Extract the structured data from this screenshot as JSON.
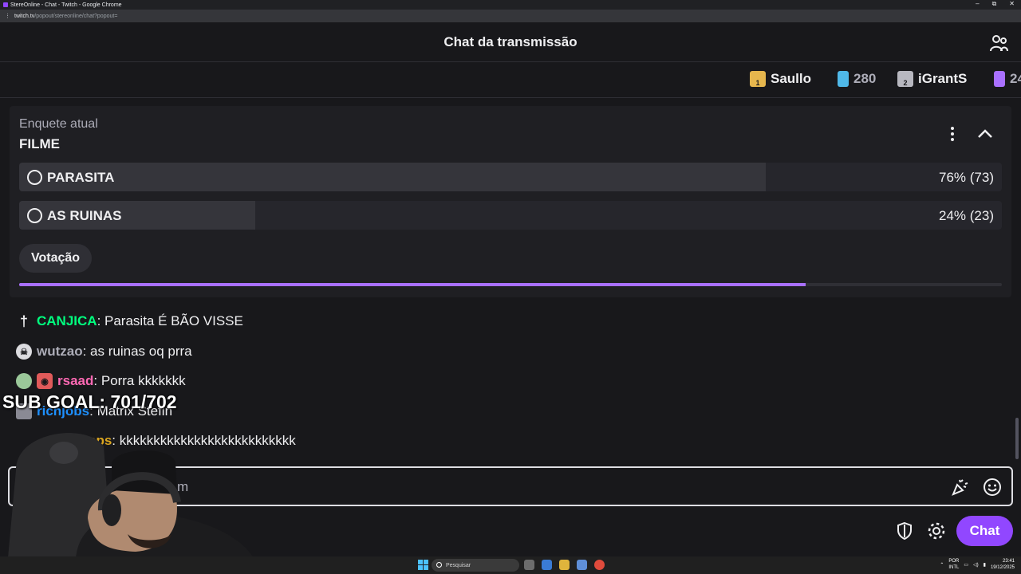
{
  "browser": {
    "window_title": "StereOnline - Chat - Twitch - Google Chrome",
    "url_host": "twitch.tv",
    "url_path": "/popout/stereonline/chat?popout=",
    "controls": [
      "–",
      "⧉",
      "✕"
    ]
  },
  "header": {
    "title": "Chat da transmissão",
    "users_icon": "users-icon"
  },
  "leaderboard": {
    "items": [
      {
        "rank": "1",
        "name": "Saullo",
        "color": "#e6b64d"
      },
      {
        "rank": "",
        "name": "280",
        "color": "#4fb8e8"
      },
      {
        "rank": "2",
        "name": "iGrantS",
        "color": "#b8b8c0"
      },
      {
        "rank": "",
        "name": "24",
        "color": "#a970ff"
      }
    ]
  },
  "poll": {
    "label": "Enquete atual",
    "title": "FILME",
    "options": [
      {
        "name": "PARASITA",
        "result": "76% (73)",
        "fraction": 0.76
      },
      {
        "name": "AS RUINAS",
        "result": "24% (23)",
        "fraction": 0.24
      }
    ],
    "vote_label": "Votação",
    "time_progress": 0.8
  },
  "messages": [
    {
      "badge": "sword-badge",
      "badge_color": "#efeff1",
      "user": "CANJICA",
      "user_color": "#00ff7f",
      "text": ": Parasita É BÃO VISSE"
    },
    {
      "badge": "skull-badge",
      "badge_color": "#dcdce0",
      "user": "wutzao",
      "user_color": "#adadb8",
      "text": ": as ruinas oq prra"
    },
    {
      "badge": "sub-badge",
      "badge_color": "#e05a5a",
      "user": "rsaad",
      "user_color": "#ff69b4",
      "text": ": Porra kkkkkkk"
    },
    {
      "badge": "tier-badge",
      "badge_color": "#8a8a94",
      "user": "richjobs",
      "user_color": "#1e90ff",
      "text": ": Matrix Stefin"
    },
    {
      "badge": "",
      "badge_color": "",
      "user": "aps",
      "user_color": "#daa520",
      "text": ": kkkkkkkkkkkkkkkkkkkkkkkkkk"
    }
  ],
  "chat_input": {
    "placeholder_visible": "m"
  },
  "bottom": {
    "chat_button": "Chat"
  },
  "overlay": {
    "sub_goal": "SUB GOAL: 701/702"
  },
  "taskbar": {
    "search_placeholder": "Pesquisar",
    "lang_top": "POR",
    "lang_bottom": "INTL",
    "time": "23:41",
    "date": "19/12/2025"
  },
  "colors": {
    "accent": "#9147ff",
    "poll_progress": "#a970ff",
    "background": "#18181b"
  }
}
